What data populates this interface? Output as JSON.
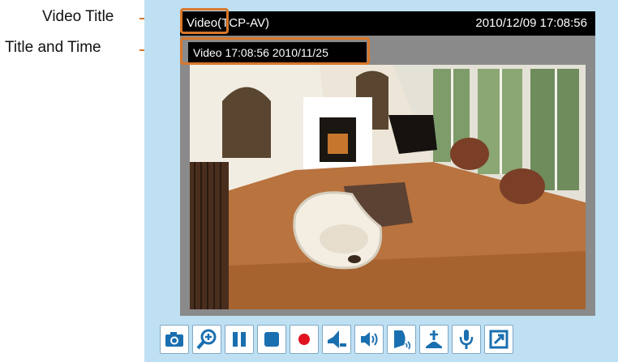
{
  "callouts": {
    "video_title_label": "Video Title",
    "title_and_time_label": "Title and Time"
  },
  "viewer": {
    "video_title": "Video(TCP-AV)",
    "datetime": "2010/12/09  17:08:56",
    "overlay_text": "Video 17:08:56  2010/11/25"
  },
  "toolbar": {
    "buttons": [
      {
        "name": "snapshot-button",
        "icon": "camera-icon"
      },
      {
        "name": "zoom-button",
        "icon": "zoom-in-icon"
      },
      {
        "name": "pause-button",
        "icon": "pause-icon"
      },
      {
        "name": "stop-button",
        "icon": "stop-icon"
      },
      {
        "name": "record-button",
        "icon": "record-icon"
      },
      {
        "name": "volume-button",
        "icon": "volume-icon"
      },
      {
        "name": "talk-button",
        "icon": "speaker-icon"
      },
      {
        "name": "mute-button",
        "icon": "mute-icon"
      },
      {
        "name": "upload-button",
        "icon": "upload-icon"
      },
      {
        "name": "mic-button",
        "icon": "microphone-icon"
      },
      {
        "name": "fullscreen-button",
        "icon": "fullscreen-icon"
      }
    ]
  },
  "colors": {
    "accent": "#d8772a",
    "panel": "#bfe0f3",
    "button_blue": "#1a6fb0",
    "record_red": "#e0131f"
  }
}
